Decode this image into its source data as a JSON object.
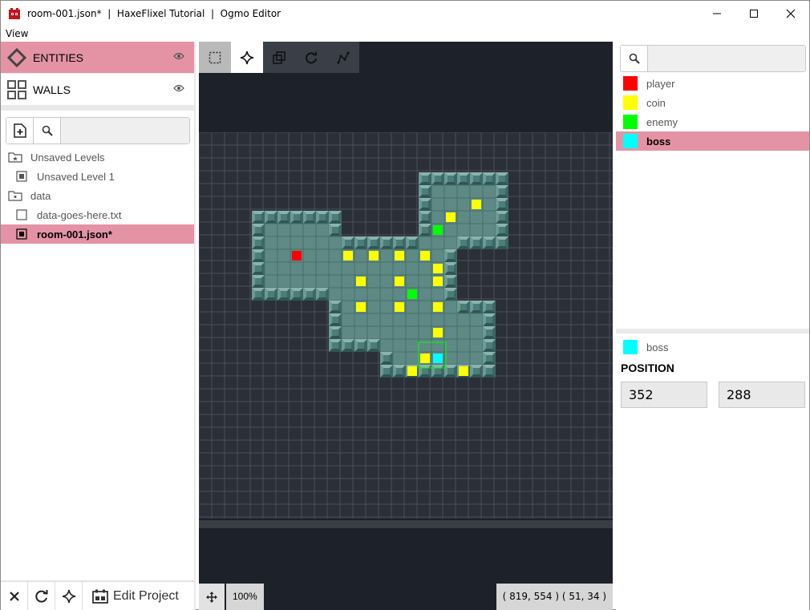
{
  "window": {
    "title": "room-001.json*  |  HaxeFlixel Tutorial  |  Ogmo Editor"
  },
  "menu": {
    "view": "View"
  },
  "layers": [
    {
      "name": "ENTITIES",
      "icon": "diamond-icon",
      "selected": true
    },
    {
      "name": "WALLS",
      "icon": "grid-icon",
      "selected": false
    }
  ],
  "files": {
    "search_placeholder": "",
    "tree": [
      {
        "label": "Unsaved Levels",
        "icon": "folder-star-icon",
        "indent": 0
      },
      {
        "label": "Unsaved Level 1",
        "icon": "level-file-icon",
        "indent": 1
      },
      {
        "label": "data",
        "icon": "folder-icon",
        "indent": 0
      },
      {
        "label": "data-goes-here.txt",
        "icon": "empty-file-icon",
        "indent": 1
      },
      {
        "label": "room-001.json*",
        "icon": "level-file-icon",
        "indent": 1,
        "selected": true
      }
    ]
  },
  "bottom": {
    "edit_project": "Edit Project"
  },
  "canvas": {
    "zoom": "100%",
    "coords": "( 819, 554 ) ( 51, 34 )"
  },
  "entities": {
    "search_placeholder": "",
    "list": [
      {
        "name": "player",
        "color": "#ff0000"
      },
      {
        "name": "coin",
        "color": "#ffff00"
      },
      {
        "name": "enemy",
        "color": "#00ff00"
      },
      {
        "name": "boss",
        "color": "#00ffff",
        "selected": true
      }
    ]
  },
  "inspector": {
    "entity_name": "boss",
    "entity_color": "#00ffff",
    "position_label": "POSITION",
    "x": "352",
    "y": "288"
  },
  "colors": {
    "accent": "#e493a5",
    "canvas_bg": "#2b2f38",
    "floor": "#5e8985",
    "wall": "#4f8280"
  }
}
